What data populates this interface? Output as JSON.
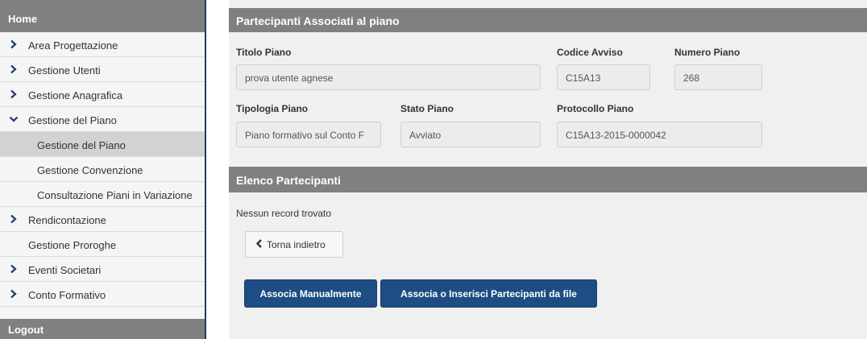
{
  "sidebar": {
    "header": "Home",
    "items": [
      {
        "label": "Area Progettazione",
        "chevron": "right"
      },
      {
        "label": "Gestione Utenti",
        "chevron": "right"
      },
      {
        "label": "Gestione Anagrafica",
        "chevron": "right"
      },
      {
        "label": "Gestione del Piano",
        "chevron": "down"
      },
      {
        "label": "Gestione del Piano",
        "active": true
      },
      {
        "label": "Gestione Convenzione"
      },
      {
        "label": "Consultazione Piani in Variazione"
      },
      {
        "label": "Rendicontazione",
        "chevron": "right"
      },
      {
        "label": "Gestione Proroghe"
      },
      {
        "label": "Eventi Societari",
        "chevron": "right"
      },
      {
        "label": "Conto Formativo",
        "chevron": "right"
      }
    ],
    "footer": "Logout"
  },
  "main": {
    "header": "Partecipanti Associati al piano",
    "fields": {
      "titolo_piano": {
        "label": "Titolo Piano",
        "value": "prova utente agnese"
      },
      "codice_avviso": {
        "label": "Codice Avviso",
        "value": "C15A13"
      },
      "numero_piano": {
        "label": "Numero Piano",
        "value": "268"
      },
      "tipologia_piano": {
        "label": "Tipologia Piano",
        "value": "Piano formativo sul Conto F"
      },
      "stato_piano": {
        "label": "Stato Piano",
        "value": "Avviato"
      },
      "protocollo_piano": {
        "label": "Protocollo Piano",
        "value": "C15A13-2015-0000042"
      }
    },
    "participants": {
      "header": "Elenco Partecipanti",
      "empty_message": "Nessun record trovato"
    },
    "buttons": {
      "back": "Torna indietro",
      "associate_manual": "Associa Manualmente",
      "associate_file": "Associa o Inserisci Partecipanti da file"
    }
  },
  "colors": {
    "header_gray": "#808080",
    "primary_blue": "#1e4d84",
    "active_item": "#d2d2d2",
    "chevron_blue": "#1f3a6b"
  },
  "icons": {
    "chevron_right": "chevron-right-icon",
    "chevron_down": "chevron-down-icon",
    "back": "chevron-left-icon"
  }
}
